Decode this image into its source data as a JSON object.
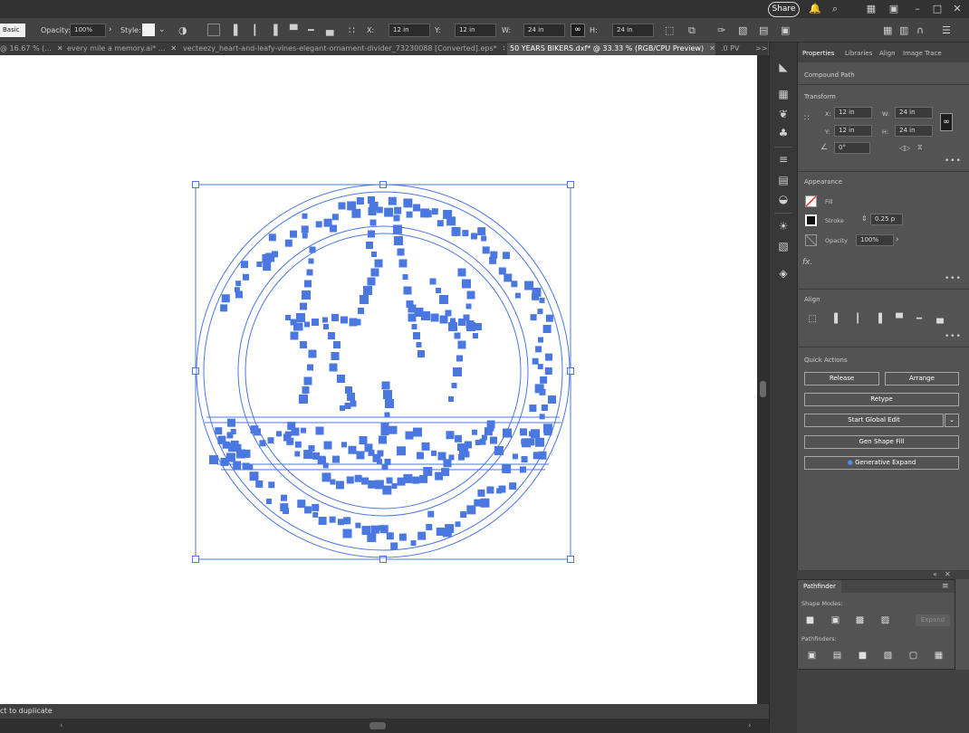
{
  "appbar": {
    "share_label": "Share",
    "icons": [
      "bell-icon",
      "search-icon",
      "workspace-icon",
      "panel-icon",
      "minimize-icon",
      "restore-icon",
      "close-icon"
    ]
  },
  "control_bar": {
    "style_preset": "Basic",
    "opacity_label": "Opacity:",
    "opacity_value": "100%",
    "style_label": "Style:",
    "x_label": "X:",
    "x_value": "12 in",
    "y_label": "Y:",
    "y_value": "12 in",
    "w_label": "W:",
    "w_value": "24 in",
    "h_label": "H:",
    "h_value": "24 in"
  },
  "tabs": [
    {
      "label": "@ 16.67 % (...",
      "active": false
    },
    {
      "label": "every mile a memory.ai* ...",
      "active": false
    },
    {
      "label": "vecteezy_heart-and-leafy-vines-elegant-ornament-divider_73230088 [Converted].eps*",
      "active": false
    },
    {
      "label": "50 YEARS BIKERS.dxf* @ 33.33 % (RGB/CPU Preview)",
      "active": true
    },
    {
      "label": ".0 PV",
      "active": false
    }
  ],
  "tabs_overflow": ">>",
  "properties": {
    "tabs": [
      "Properties",
      "Libraries",
      "Align",
      "Image Trace"
    ],
    "object_type": "Compound Path",
    "transform": {
      "title": "Transform",
      "x_label": "X:",
      "x_value": "12 in",
      "y_label": "Y:",
      "y_value": "12 in",
      "w_label": "W:",
      "w_value": "24 in",
      "h_label": "H:",
      "h_value": "24 in",
      "angle_value": "0°"
    },
    "appearance": {
      "title": "Appearance",
      "fill_label": "Fill",
      "stroke_label": "Stroke",
      "stroke_value": "0.25 p",
      "opacity_label": "Opacity",
      "opacity_value": "100%",
      "fx_label": "fx."
    },
    "align": {
      "title": "Align"
    },
    "quick_actions": {
      "title": "Quick Actions",
      "release": "Release",
      "arrange": "Arrange",
      "retype": "Retype",
      "start_global_edit": "Start Global Edit",
      "gen_shape_fill": "Gen Shape Fill",
      "generative_expand": "Generative Expand"
    }
  },
  "pathfinder": {
    "title": "Pathfinder",
    "shape_modes": "Shape Modes:",
    "expand": "Expand",
    "pathfinders": "Pathfinders:"
  },
  "status": {
    "text": "ct to duplicate"
  },
  "colors": {
    "selection_blue": "#4a78e0",
    "canvas": "#ffffff",
    "ui_dark": "#535353"
  }
}
